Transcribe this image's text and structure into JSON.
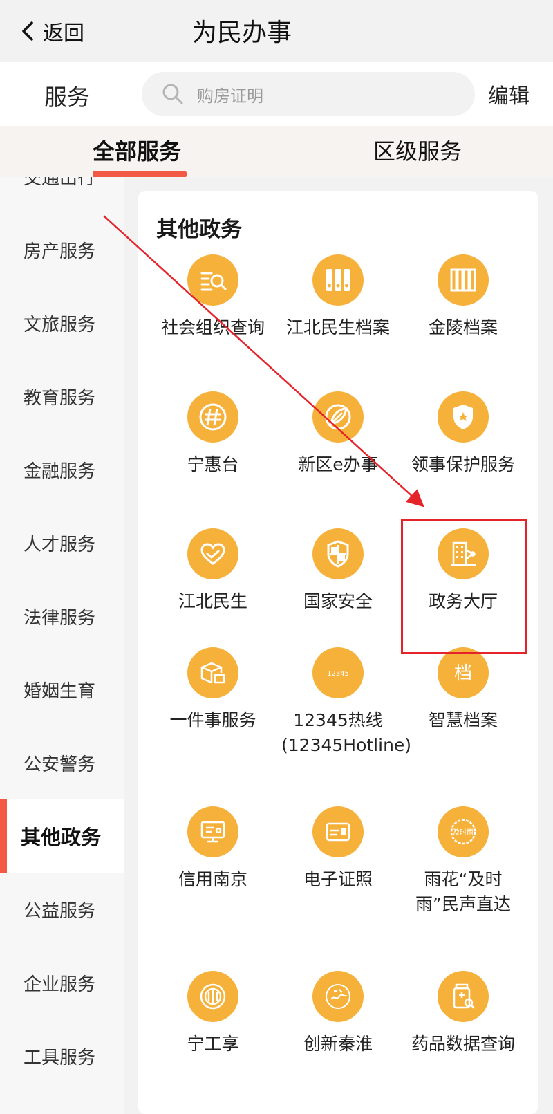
{
  "topbar": {
    "back_label": "返回",
    "title": "为民办事"
  },
  "search": {
    "section_label": "服务",
    "placeholder": "购房证明",
    "edit_label": "编辑"
  },
  "tabs": [
    {
      "label": "全部服务",
      "active": true
    },
    {
      "label": "区级服务",
      "active": false
    }
  ],
  "sidebar": {
    "items": [
      {
        "label": "交通出行"
      },
      {
        "label": "房产服务"
      },
      {
        "label": "文旅服务"
      },
      {
        "label": "教育服务"
      },
      {
        "label": "金融服务"
      },
      {
        "label": "人才服务"
      },
      {
        "label": "法律服务"
      },
      {
        "label": "婚姻生育"
      },
      {
        "label": "公安警务"
      },
      {
        "label": "其他政务",
        "active": true
      },
      {
        "label": "公益服务"
      },
      {
        "label": "企业服务"
      },
      {
        "label": "工具服务"
      }
    ]
  },
  "section": {
    "title": "其他政务",
    "items": [
      {
        "label": "社会组织查询",
        "icon": "search-list-icon"
      },
      {
        "label": "江北民生档案",
        "icon": "binders-icon"
      },
      {
        "label": "金陵档案",
        "icon": "books-icon"
      },
      {
        "label": "宁惠台",
        "icon": "seal-icon"
      },
      {
        "label": "新区e办事",
        "icon": "leaf-icon"
      },
      {
        "label": "领事保护服务",
        "icon": "shield-star-icon"
      },
      {
        "label": "江北民生",
        "icon": "heart-hands-icon"
      },
      {
        "label": "国家安全",
        "icon": "security-shield-icon"
      },
      {
        "label": "政务大厅",
        "icon": "building-icon"
      },
      {
        "label": "一件事服务",
        "icon": "boxes-icon"
      },
      {
        "label": "12345热线(12345Hotline)",
        "icon": "hotline-icon",
        "icon_text": "12345"
      },
      {
        "label": "智慧档案",
        "icon": "archive-seal-icon",
        "icon_text": "档"
      },
      {
        "label": "信用南京",
        "icon": "monitor-icon"
      },
      {
        "label": "电子证照",
        "icon": "id-card-icon"
      },
      {
        "label": "雨花“及时雨”民声直达",
        "icon": "badge-icon",
        "icon_text": "及时雨"
      },
      {
        "label": "宁工享",
        "icon": "union-logo-icon"
      },
      {
        "label": "创新秦淮",
        "icon": "qinhuai-seal-icon"
      },
      {
        "label": "药品数据查询",
        "icon": "medicine-search-icon"
      }
    ]
  },
  "annotation": {
    "color": "#e4232a"
  },
  "colors": {
    "accent": "#f25a45",
    "icon_bg": "#f6b13b"
  }
}
